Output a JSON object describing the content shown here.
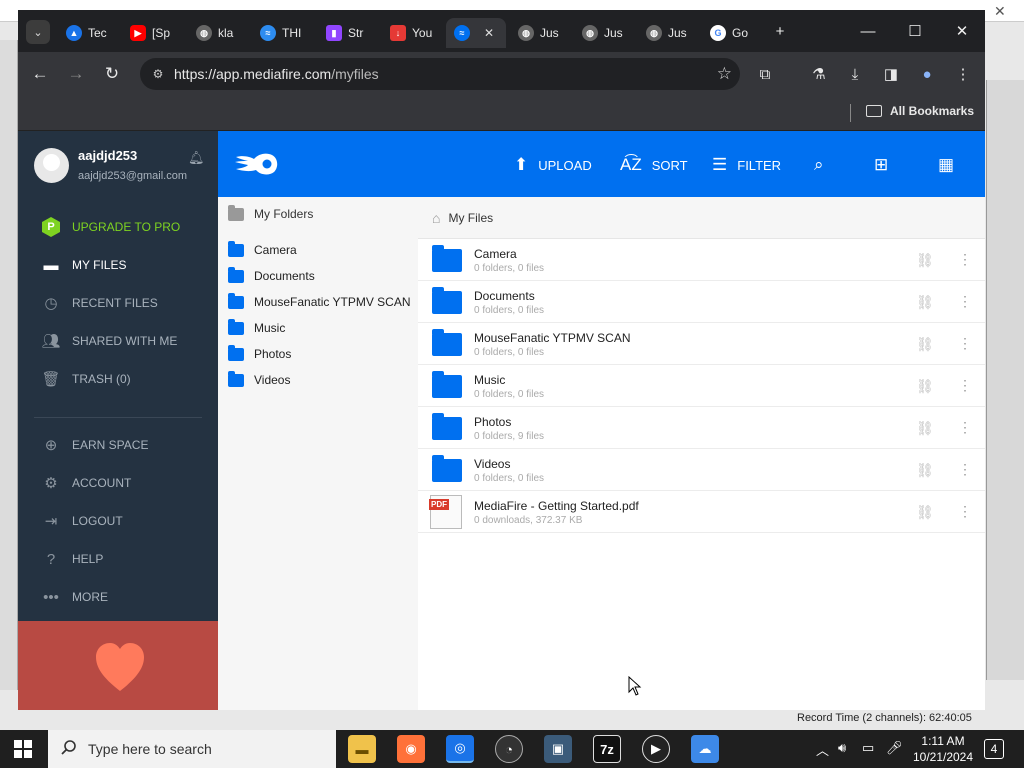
{
  "background_app": {
    "record_time": "Record Time (2 channels): 62:40:05"
  },
  "browser": {
    "tabs": [
      {
        "label": "Tec",
        "favicon_color": "#1a73e8"
      },
      {
        "label": "[Sp",
        "favicon_color": "#ff0000"
      },
      {
        "label": "kla",
        "favicon_color": "#666666"
      },
      {
        "label": "THI",
        "favicon_color": "#2d8cf0"
      },
      {
        "label": "Str",
        "favicon_color": "#9146ff"
      },
      {
        "label": "You",
        "favicon_color": "#e53935"
      },
      {
        "label": "",
        "favicon_color": "#0070f0",
        "active": true
      },
      {
        "label": "Jus",
        "favicon_color": "#666666"
      },
      {
        "label": "Jus",
        "favicon_color": "#666666"
      },
      {
        "label": "Jus",
        "favicon_color": "#666666"
      },
      {
        "label": "Go",
        "favicon_color": "#ffffff"
      }
    ],
    "url_host": "https://app.mediafire.com",
    "url_path": "/myfiles",
    "all_bookmarks": "All Bookmarks"
  },
  "mediafire": {
    "user": {
      "name": "aajdjd253",
      "email": "aajdjd253@gmail.com"
    },
    "sidebar": {
      "upgrade": "UPGRADE TO PRO",
      "my_files": "MY FILES",
      "recent_files": "RECENT FILES",
      "shared_with_me": "SHARED WITH ME",
      "trash": "TRASH (0)",
      "earn_space": "EARN SPACE",
      "account": "ACCOUNT",
      "logout": "LOGOUT",
      "help": "HELP",
      "more": "MORE"
    },
    "header": {
      "upload": "UPLOAD",
      "sort": "SORT",
      "filter": "FILTER"
    },
    "tree": {
      "title": "My Folders",
      "items": [
        "Camera",
        "Documents",
        "MouseFanatic YTPMV SCAN",
        "Music",
        "Photos",
        "Videos"
      ]
    },
    "breadcrumb": "My Files",
    "files": [
      {
        "name": "Camera",
        "meta": "0 folders, 0 files",
        "type": "folder"
      },
      {
        "name": "Documents",
        "meta": "0 folders, 0 files",
        "type": "folder"
      },
      {
        "name": "MouseFanatic YTPMV SCAN",
        "meta": "0 folders, 0 files",
        "type": "folder"
      },
      {
        "name": "Music",
        "meta": "0 folders, 0 files",
        "type": "folder"
      },
      {
        "name": "Photos",
        "meta": "0 folders, 9 files",
        "type": "folder"
      },
      {
        "name": "Videos",
        "meta": "0 folders, 0 files",
        "type": "folder"
      },
      {
        "name": "MediaFire - Getting Started.pdf",
        "meta": "0 downloads, 372.37 KB",
        "type": "pdf"
      }
    ]
  },
  "taskbar": {
    "search_placeholder": "Type here to search",
    "time": "1:11 AM",
    "date": "10/21/2024",
    "notifications": "4"
  }
}
